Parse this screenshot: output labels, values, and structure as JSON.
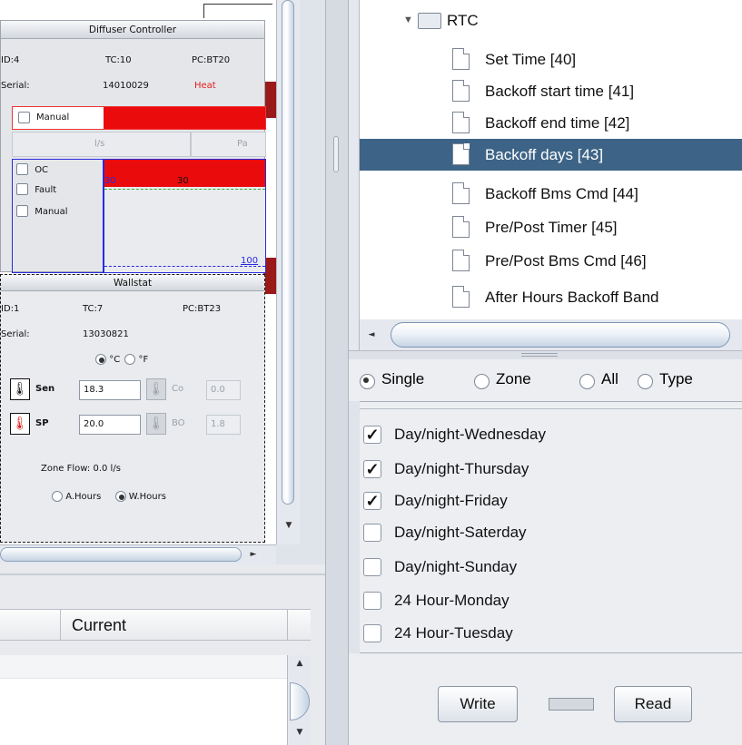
{
  "diffuser": {
    "title": "Diffuser Controller",
    "id_label": "ID:4",
    "tc_label": "TC:10",
    "pc_label": "PC:BT20",
    "serial_label": "Serial:",
    "serial_value": "14010029",
    "mode_status": "Heat",
    "mode_status_color": "#e61c1c",
    "manual_label": "Manual",
    "flow_unit": "l/s",
    "pressure_unit": "Pa",
    "checkboxes": [
      "OC",
      "Fault",
      "Manual"
    ],
    "bar_value_left": "30",
    "bar_value_mid": "30",
    "bar_max": "100",
    "accent_red": "#ea0c0c",
    "accent_blue": "#2a2be0"
  },
  "wallstat": {
    "title": "Wallstat",
    "id_label": "ID:1",
    "tc_label": "TC:7",
    "pc_label": "PC:BT23",
    "serial_label": "Serial:",
    "serial_value": "13030821",
    "unit_c": "°C",
    "unit_f": "°F",
    "selected_unit": "°C",
    "sen_label": "Sen",
    "sen_value": "18.3",
    "sp_label": "SP",
    "sp_value": "20.0",
    "co_label": "Co",
    "co_value": "0.0",
    "bo_label": "BO",
    "bo_value": "1.8",
    "zone_flow": "Zone Flow: 0.0 l/s",
    "hours_options": [
      "A.Hours",
      "W.Hours"
    ],
    "selected_hours": "W.Hours"
  },
  "lower_table": {
    "column_current": "Current"
  },
  "tree": {
    "folder_label": "RTC",
    "items": [
      "Set Time [40]",
      "Backoff start time [41]",
      "Backoff end time [42]",
      "Backoff days [43]",
      "Backoff Bms Cmd [44]",
      "Pre/Post Timer [45]",
      "Pre/Post Bms Cmd [46]",
      "After Hours Backoff Band"
    ],
    "selected_item": "Backoff days [43]",
    "selection_color": "#3d6487"
  },
  "scope": {
    "options": [
      "Single",
      "Zone",
      "All",
      "Type"
    ],
    "selected": "Single"
  },
  "days_list": [
    {
      "label": "Day/night-Wednesday",
      "checked": true
    },
    {
      "label": "Day/night-Thursday",
      "checked": true
    },
    {
      "label": "Day/night-Friday",
      "checked": true
    },
    {
      "label": "Day/night-Saterday",
      "checked": false
    },
    {
      "label": "Day/night-Sunday",
      "checked": false
    },
    {
      "label": "24 Hour-Monday",
      "checked": false
    },
    {
      "label": "24 Hour-Tuesday",
      "checked": false
    }
  ],
  "buttons": {
    "write": "Write",
    "read": "Read"
  }
}
